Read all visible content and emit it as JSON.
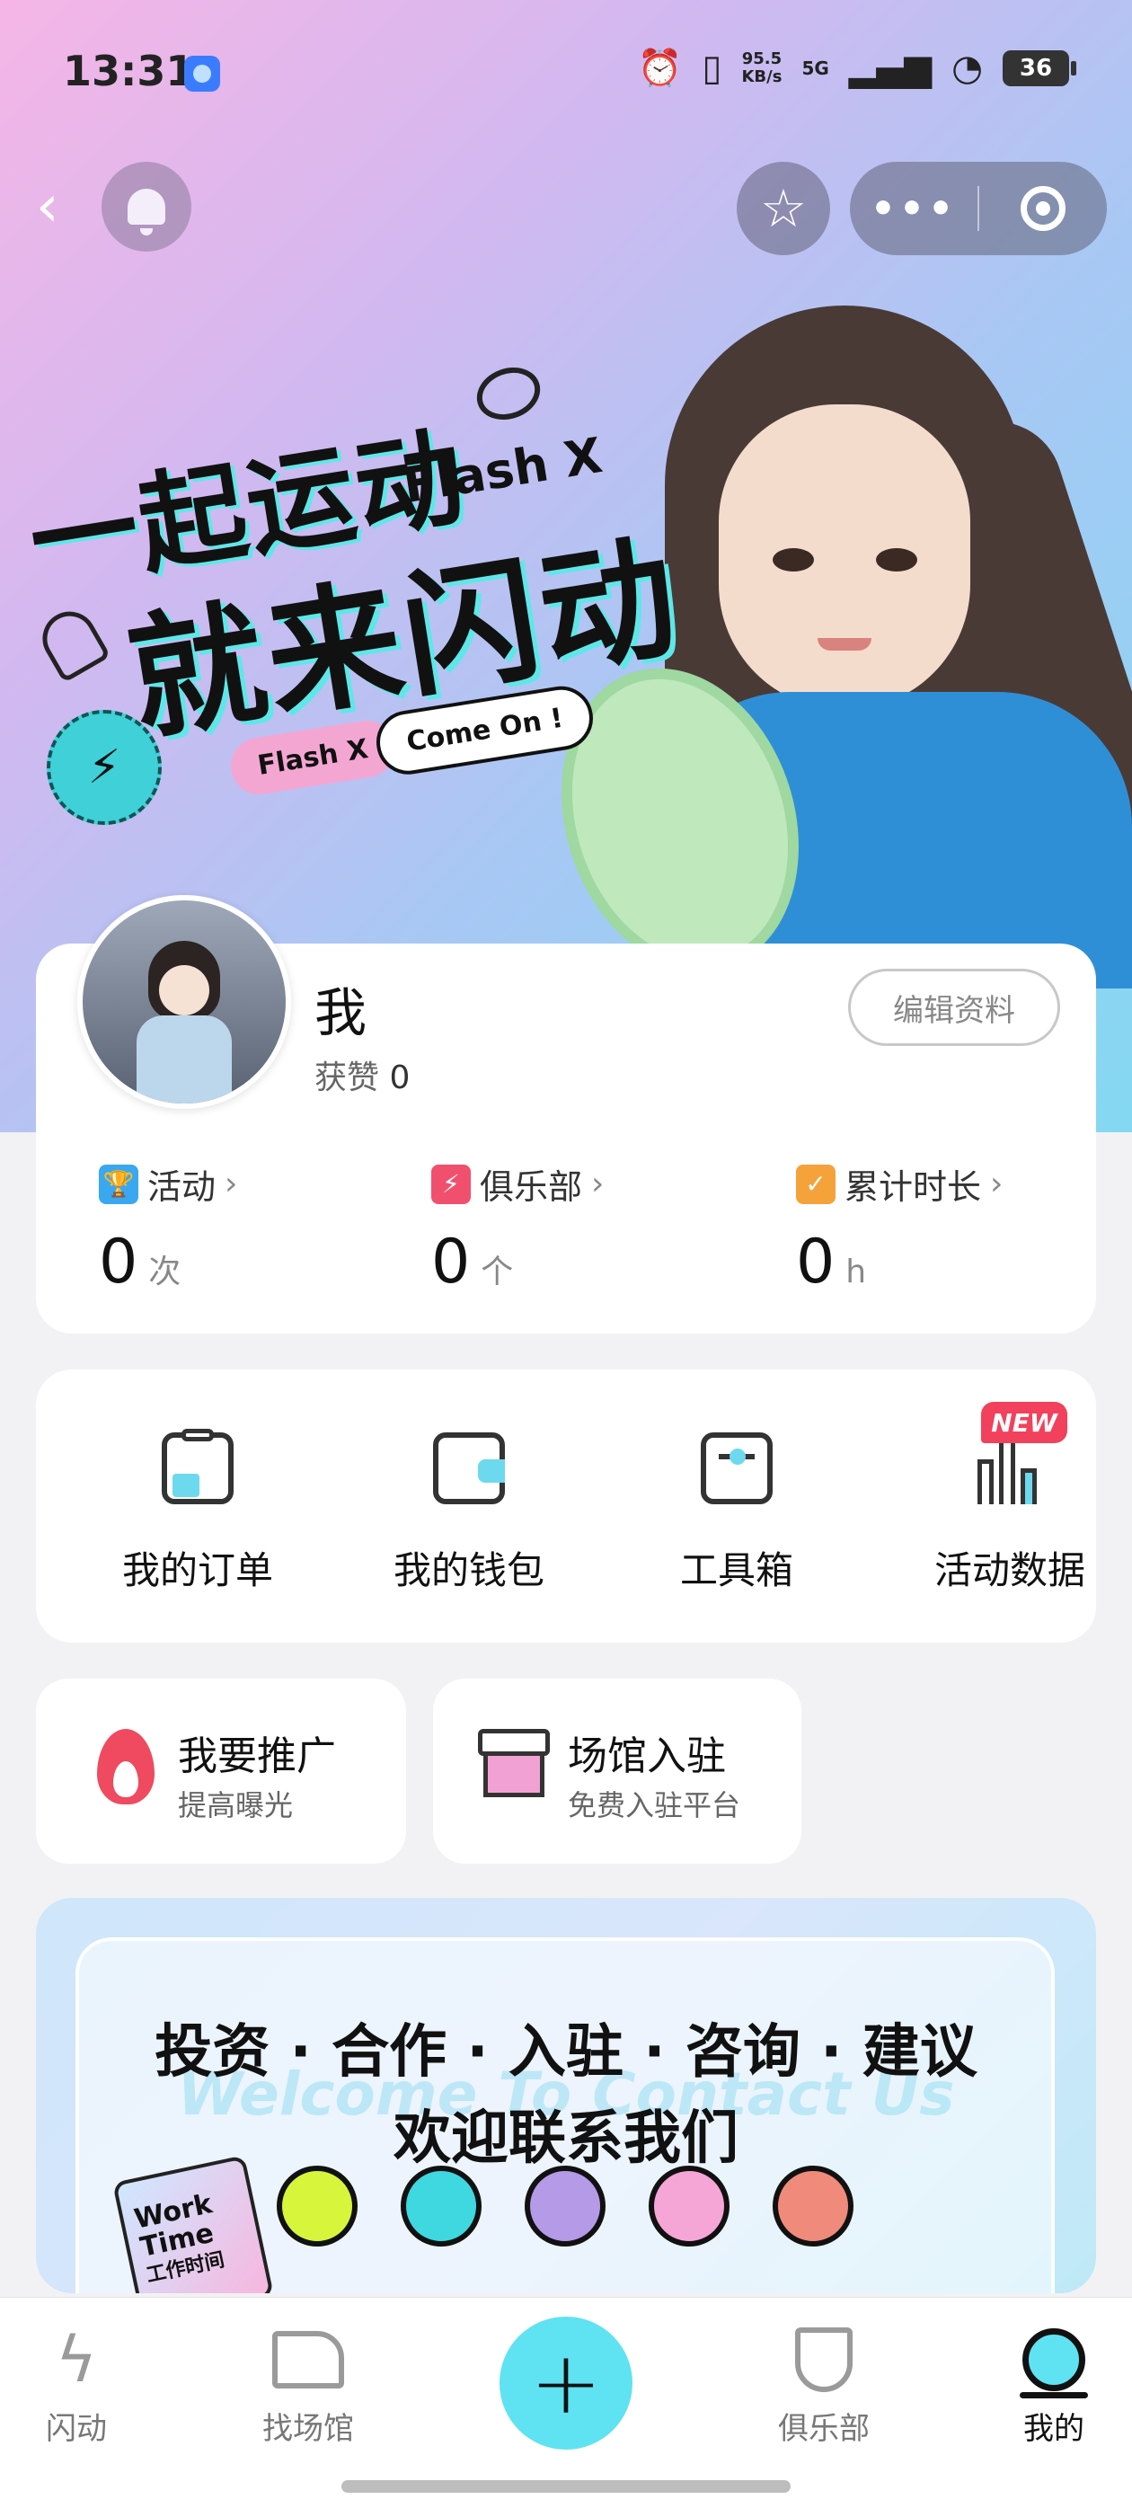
{
  "status_bar": {
    "time": "13:31",
    "net_speed": "95.5",
    "net_unit": "KB/s",
    "network": "5G",
    "battery": "36"
  },
  "hero": {
    "slogan_line1": "一起运动",
    "brand": "Flash X",
    "slogan_line2": "就来闪动",
    "pill_brand": "Flash X",
    "pill_text": "Come On !",
    "gradient": [
      "#f5b6e6",
      "#a8c8f4",
      "#84d8f2"
    ]
  },
  "profile": {
    "name": "我",
    "likes_label": "获赞",
    "likes_value": "0",
    "edit_button": "编辑资料"
  },
  "stats": [
    {
      "icon": "trophy-icon",
      "label": "活动",
      "value": "0",
      "unit": "次",
      "color": "#3aa8f0"
    },
    {
      "icon": "club-badge-icon",
      "label": "俱乐部",
      "value": "0",
      "unit": "个",
      "color": "#f0506e"
    },
    {
      "icon": "clipboard-check-icon",
      "label": "累计时长",
      "value": "0",
      "unit": "h",
      "color": "#f5a23a"
    }
  ],
  "menu": [
    {
      "icon": "order-icon",
      "label": "我的订单"
    },
    {
      "icon": "wallet-icon",
      "label": "我的钱包"
    },
    {
      "icon": "toolbox-icon",
      "label": "工具箱"
    },
    {
      "icon": "bar-chart-icon",
      "label": "活动数据",
      "badge": "NEW"
    }
  ],
  "promos": [
    {
      "icon": "flame-icon",
      "title": "我要推广",
      "subtitle": "提高曝光"
    },
    {
      "icon": "shop-icon",
      "title": "场馆入驻",
      "subtitle": "免费入驻平台"
    }
  ],
  "banner": {
    "line1": "投资 · 合作 · 入驻 · 咨询 · 建议",
    "line2": "欢迎联系我们",
    "ghost_text": "Welcome To Contact Us",
    "tag_line1": "Work",
    "tag_line2": "Time",
    "tag_line3": "工作时间",
    "balls": [
      "softball-icon",
      "volleyball-icon",
      "frisbee-icon",
      "soccer-icon",
      "basketball-icon"
    ]
  },
  "bottom_nav": {
    "items": [
      {
        "icon": "lightning-icon",
        "label": "闪动",
        "active": false
      },
      {
        "icon": "venue-icon",
        "label": "找场馆",
        "active": false
      },
      {
        "icon": "plus-icon",
        "label": "+",
        "active": false
      },
      {
        "icon": "club-icon",
        "label": "俱乐部",
        "active": false
      },
      {
        "icon": "profile-icon",
        "label": "我的",
        "active": true
      }
    ],
    "accent": "#5fe2f2"
  }
}
